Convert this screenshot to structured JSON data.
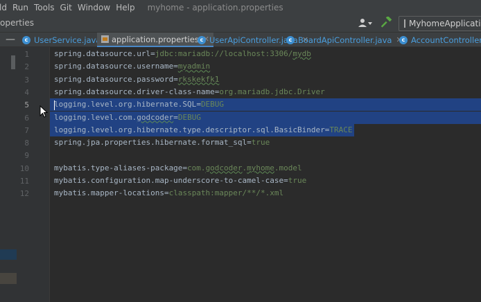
{
  "menubar": {
    "items": [
      "ld",
      "Run",
      "Tools",
      "Git",
      "Window",
      "Help"
    ],
    "title": "myhome - application.properties"
  },
  "toolbar": {
    "crumb": "operties",
    "run_config": "MyhomeApplication"
  },
  "tabs": [
    {
      "label": "UserService.java",
      "type": "class",
      "active": false
    },
    {
      "label": "application.properties",
      "type": "properties",
      "active": true
    },
    {
      "label": "UserApiController.java",
      "type": "class",
      "active": false
    },
    {
      "label": "BoardApiController.java",
      "type": "class",
      "active": false
    },
    {
      "label": "AccountController.java",
      "type": "class",
      "active": false
    }
  ],
  "editor": {
    "line_numbers": [
      "1",
      "2",
      "3",
      "4",
      "5",
      "6",
      "7",
      "8",
      "9",
      "10",
      "11",
      "12"
    ],
    "current_line": "5",
    "selected_lines": [
      "5",
      "6",
      "7"
    ],
    "lines": [
      {
        "key": "spring.datasource.url",
        "value": "jdbc:mariadb://localhost:3306/mydb"
      },
      {
        "key": "spring.datasource.username",
        "value": "myadmin"
      },
      {
        "key": "spring.datasource.password",
        "value": "rkskekfk1"
      },
      {
        "key": "spring.datasource.driver-class-name",
        "value": "org.mariadb.jdbc.Driver"
      },
      {
        "key": "logging.level.org.hibernate.SQL",
        "value": "DEBUG"
      },
      {
        "key": "logging.level.com.godcoder",
        "value": "DEBUG"
      },
      {
        "key": "logging.level.org.hibernate.type.descriptor.sql.BasicBinder",
        "value": "TRACE"
      },
      {
        "key": "spring.jpa.properties.hibernate.format_sql",
        "value": "true"
      },
      {
        "key": "",
        "value": ""
      },
      {
        "key": "mybatis.type-aliases-package",
        "value": "com.godcoder.myhome.model"
      },
      {
        "key": "mybatis.configuration.map-underscore-to-camel-case",
        "value": "true"
      },
      {
        "key": "mybatis.mapper-locations",
        "value": "classpath:mapper/**/*.xml"
      }
    ]
  },
  "colors": {
    "background": "#2b2b2b",
    "selection": "#214283",
    "value_green": "#6a8759",
    "tab_link": "#4a9ede"
  }
}
